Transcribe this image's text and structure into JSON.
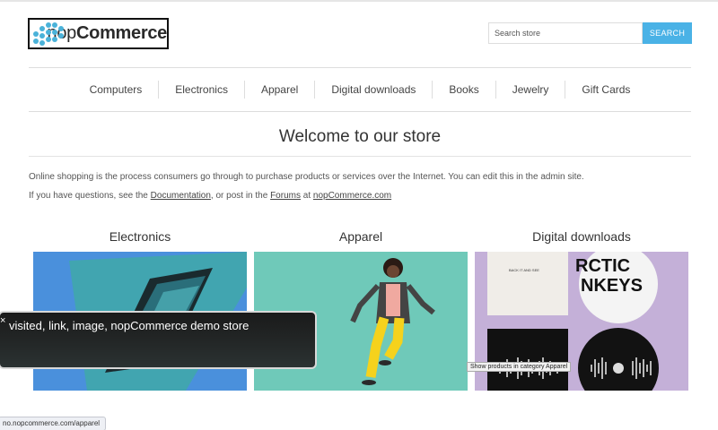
{
  "logo": {
    "text_light": "nop",
    "text_bold": "Commerce"
  },
  "search": {
    "placeholder": "Search store",
    "button_label": "SEARCH"
  },
  "nav": {
    "items": [
      {
        "label": "Computers"
      },
      {
        "label": "Electronics"
      },
      {
        "label": "Apparel"
      },
      {
        "label": "Digital downloads"
      },
      {
        "label": "Books"
      },
      {
        "label": "Jewelry"
      },
      {
        "label": "Gift Cards"
      }
    ]
  },
  "welcome": {
    "title": "Welcome to our store",
    "paragraph1": "Online shopping is the process consumers go through to purchase products or services over the Internet. You can edit this in the admin site.",
    "p2_before": "If you have questions, see the ",
    "p2_link1": "Documentation",
    "p2_middle": ", or post in the ",
    "p2_link2": "Forums",
    "p2_after": " at ",
    "p2_link3": "nopCommerce.com"
  },
  "categories": [
    {
      "title": "Electronics"
    },
    {
      "title": "Apparel"
    },
    {
      "title": "Digital downloads"
    }
  ],
  "album_text": {
    "sleeve_small": "BACK IT AND SEE",
    "disc_text": "RCTIC\nNKEYS"
  },
  "voiceover": {
    "close_glyph": "×",
    "text": "visited, link, image, nopCommerce demo store"
  },
  "tooltip": {
    "text": "Show products in category Apparel"
  },
  "status_bar": {
    "url": "no.nopcommerce.com/apparel"
  },
  "colors": {
    "accent": "#4ab2e6",
    "logo_dots": "#4ab2d9"
  }
}
